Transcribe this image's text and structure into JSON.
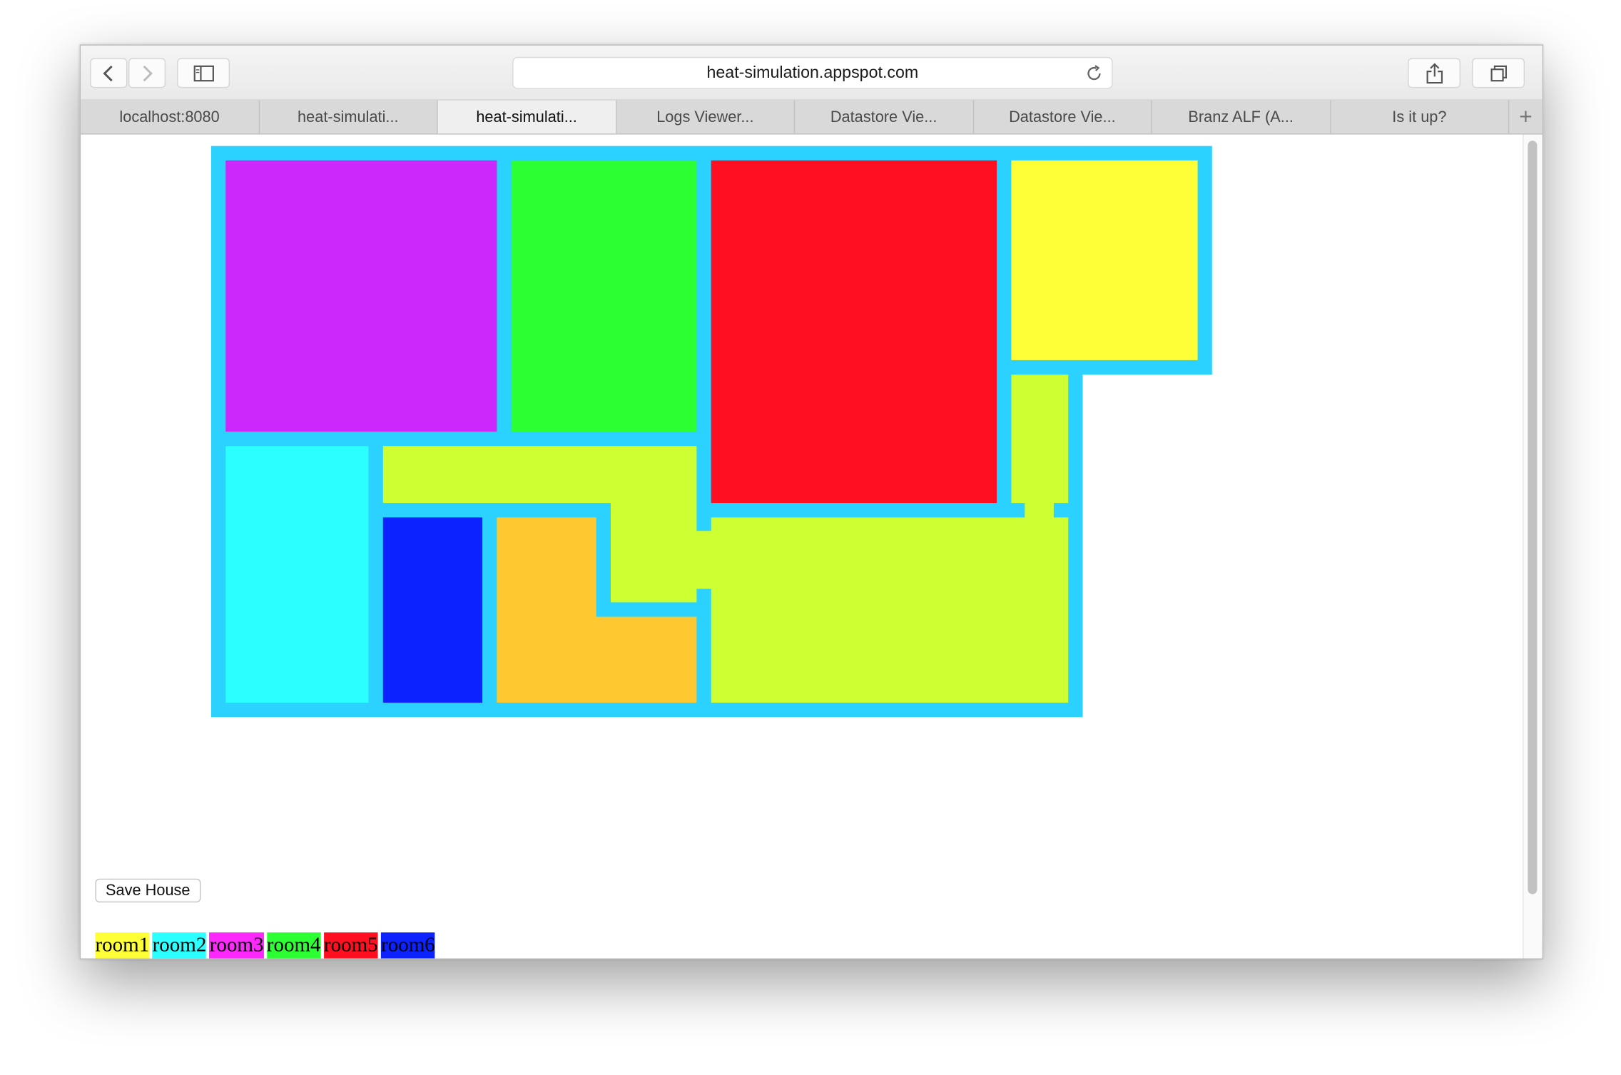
{
  "browser": {
    "url": "heat-simulation.appspot.com",
    "tabs": [
      {
        "label": "localhost:8080",
        "active": false
      },
      {
        "label": "heat-simulati...",
        "active": false
      },
      {
        "label": "heat-simulati...",
        "active": true
      },
      {
        "label": "Logs Viewer...",
        "active": false
      },
      {
        "label": "Datastore Vie...",
        "active": false
      },
      {
        "label": "Datastore Vie...",
        "active": false
      },
      {
        "label": "Branz ALF (A...",
        "active": false
      },
      {
        "label": "Is it up?",
        "active": false
      }
    ],
    "new_tab_label": "+"
  },
  "icons": {
    "back": "chevron-left-icon",
    "forward": "chevron-right-icon",
    "sidebar": "sidebar-icon",
    "reload": "reload-icon",
    "share": "share-icon",
    "tabs_overview": "tabs-overview-icon"
  },
  "floorplan": {
    "wall_color": "#2bd1ff",
    "rooms": [
      {
        "name": "room-purple",
        "color": "#cc28fc"
      },
      {
        "name": "room-green",
        "color": "#2cff32"
      },
      {
        "name": "room-red",
        "color": "#ff0f1f"
      },
      {
        "name": "room-yellow",
        "color": "#ffff38"
      },
      {
        "name": "room-cyan",
        "color": "#2cffff"
      },
      {
        "name": "room-blue",
        "color": "#0c22ff"
      },
      {
        "name": "room-orange",
        "color": "#fec930"
      },
      {
        "name": "room-lime",
        "color": "#cdff32"
      }
    ]
  },
  "save_button_label": "Save House",
  "legend": [
    {
      "label": "room1",
      "color": "#ffff38"
    },
    {
      "label": "room2",
      "color": "#2cffff"
    },
    {
      "label": "room3",
      "color": "#fc28fc"
    },
    {
      "label": "room4",
      "color": "#2cff32"
    },
    {
      "label": "room5",
      "color": "#ff0f1f"
    },
    {
      "label": "room6",
      "color": "#0c22ff"
    }
  ]
}
